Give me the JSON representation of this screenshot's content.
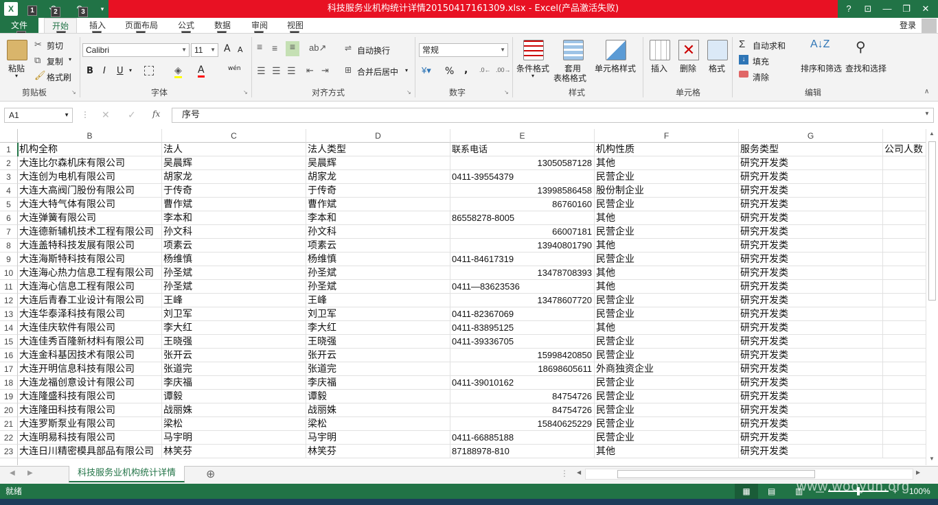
{
  "window": {
    "title": "科技服务业机构统计详情20150417161309.xlsx -  Excel(产品激活失败)",
    "help": "?",
    "restore_ribbon": "⊡",
    "minimize": "—",
    "maximize": "❐",
    "close": "✕",
    "login": "登录",
    "qat_keytips": [
      "1",
      "2",
      "3"
    ]
  },
  "tabs": [
    {
      "label": "文件",
      "key": "F"
    },
    {
      "label": "开始",
      "key": "H"
    },
    {
      "label": "插入",
      "key": "N"
    },
    {
      "label": "页面布局",
      "key": "P"
    },
    {
      "label": "公式",
      "key": "M"
    },
    {
      "label": "数据",
      "key": "A"
    },
    {
      "label": "审阅",
      "key": "R"
    },
    {
      "label": "视图",
      "key": "W"
    }
  ],
  "ribbon": {
    "clipboard": {
      "paste": "粘贴",
      "cut": "剪切",
      "copy": "复制",
      "format_painter": "格式刷",
      "label": "剪贴板"
    },
    "font": {
      "name": "Calibri",
      "size": "11",
      "label": "字体",
      "bold": "B",
      "italic": "I",
      "underline": "U",
      "grow": "A",
      "shrink": "A",
      "phonetic": "wén"
    },
    "alignment": {
      "wrap": "自动换行",
      "merge": "合并后居中",
      "label": "对齐方式"
    },
    "number": {
      "format": "常规",
      "percent": "%",
      "comma": ",",
      "label": "数字"
    },
    "styles": {
      "conditional": "条件格式",
      "table1": "套用",
      "table2": "表格格式",
      "cell_styles": "单元格样式",
      "label": "样式"
    },
    "cells": {
      "insert": "插入",
      "delete": "删除",
      "format": "格式",
      "label": "单元格"
    },
    "editing": {
      "autosum": "自动求和",
      "fill": "填充",
      "clear": "清除",
      "sort": "排序和筛选",
      "find": "查找和选择",
      "label": "编辑"
    }
  },
  "formula_bar": {
    "name_box": "A1",
    "fx": "fx",
    "value": "序号"
  },
  "columns": [
    "B",
    "C",
    "D",
    "E",
    "F",
    "G"
  ],
  "rows": [
    {
      "n": "1",
      "b": "机构全称",
      "c": "法人",
      "d": "法人类型",
      "e": "联系电话",
      "e_num": false,
      "f": "机构性质",
      "g": "服务类型",
      "h": "公司人数"
    },
    {
      "n": "2",
      "b": "大连比尔森机床有限公司",
      "c": "吴晨辉",
      "d": "吴晨辉",
      "e": "13050587128",
      "e_num": true,
      "f": "其他",
      "g": "研究开发类",
      "h": ""
    },
    {
      "n": "3",
      "b": "大连创为电机有限公司",
      "c": "胡家龙",
      "d": "胡家龙",
      "e": "0411-39554379",
      "e_num": false,
      "f": "民营企业",
      "g": "研究开发类",
      "h": ""
    },
    {
      "n": "4",
      "b": "大连大高阀门股份有限公司",
      "c": "于传奇",
      "d": "于传奇",
      "e": "13998586458",
      "e_num": true,
      "f": "股份制企业",
      "g": "研究开发类",
      "h": ""
    },
    {
      "n": "5",
      "b": "大连大特气体有限公司",
      "c": "曹作斌",
      "d": "曹作斌",
      "e": "86760160",
      "e_num": true,
      "f": "民营企业",
      "g": "研究开发类",
      "h": ""
    },
    {
      "n": "6",
      "b": "大连弹簧有限公司",
      "c": "李本和",
      "d": "李本和",
      "e": "86558278-8005",
      "e_num": false,
      "f": "其他",
      "g": "研究开发类",
      "h": ""
    },
    {
      "n": "7",
      "b": "大连德新辅机技术工程有限公司",
      "c": "孙文科",
      "d": "孙文科",
      "e": "66007181",
      "e_num": true,
      "f": "民营企业",
      "g": "研究开发类",
      "h": ""
    },
    {
      "n": "8",
      "b": "大连盖特科技发展有限公司",
      "c": "项素云",
      "d": "项素云",
      "e": "13940801790",
      "e_num": true,
      "f": "其他",
      "g": "研究开发类",
      "h": ""
    },
    {
      "n": "9",
      "b": "大连海斯特科技有限公司",
      "c": "杨维慎",
      "d": "杨维慎",
      "e": "0411-84617319",
      "e_num": false,
      "f": "民营企业",
      "g": "研究开发类",
      "h": ""
    },
    {
      "n": "10",
      "b": "大连海心热力信息工程有限公司",
      "c": "孙圣斌",
      "d": "孙圣斌",
      "e": "13478708393",
      "e_num": true,
      "f": "其他",
      "g": "研究开发类",
      "h": ""
    },
    {
      "n": "11",
      "b": "大连海心信息工程有限公司",
      "c": "孙圣斌",
      "d": "孙圣斌",
      "e": "0411—83623536",
      "e_num": false,
      "f": "其他",
      "g": "研究开发类",
      "h": ""
    },
    {
      "n": "12",
      "b": "大连后青春工业设计有限公司",
      "c": "王峰",
      "d": "王峰",
      "e": "13478607720",
      "e_num": true,
      "f": "民营企业",
      "g": "研究开发类",
      "h": ""
    },
    {
      "n": "13",
      "b": "大连华泰泽科技有限公司",
      "c": "刘卫军",
      "d": "刘卫军",
      "e": "0411-82367069",
      "e_num": false,
      "f": "民营企业",
      "g": "研究开发类",
      "h": ""
    },
    {
      "n": "14",
      "b": "大连佳庆软件有限公司",
      "c": "李大红",
      "d": "李大红",
      "e": "0411-83895125",
      "e_num": false,
      "f": "其他",
      "g": "研究开发类",
      "h": ""
    },
    {
      "n": "15",
      "b": "大连佳秀百隆新材料有限公司",
      "c": "王晓强",
      "d": "王晓强",
      "e": "0411-39336705",
      "e_num": false,
      "f": "民营企业",
      "g": "研究开发类",
      "h": ""
    },
    {
      "n": "16",
      "b": "大连金科基因技术有限公司",
      "c": "张开云",
      "d": "张开云",
      "e": "15998420850",
      "e_num": true,
      "f": "民营企业",
      "g": "研究开发类",
      "h": ""
    },
    {
      "n": "17",
      "b": "大连开明信息科技有限公司",
      "c": "张道完",
      "d": "张道完",
      "e": "18698605611",
      "e_num": true,
      "f": "外商独资企业",
      "g": "研究开发类",
      "h": ""
    },
    {
      "n": "18",
      "b": "大连龙福创意设计有限公司",
      "c": "李庆福",
      "d": "李庆福",
      "e": "0411-39010162",
      "e_num": false,
      "f": "民营企业",
      "g": "研究开发类",
      "h": ""
    },
    {
      "n": "19",
      "b": "大连隆盛科技有限公司",
      "c": "谭毅",
      "d": "谭毅",
      "e": "84754726",
      "e_num": true,
      "f": "民营企业",
      "g": "研究开发类",
      "h": ""
    },
    {
      "n": "20",
      "b": "大连隆田科技有限公司",
      "c": "战丽姝",
      "d": "战丽姝",
      "e": "84754726",
      "e_num": true,
      "f": "民营企业",
      "g": "研究开发类",
      "h": ""
    },
    {
      "n": "21",
      "b": "大连罗斯泵业有限公司",
      "c": "梁松",
      "d": "梁松",
      "e": "15840625229",
      "e_num": true,
      "f": "民营企业",
      "g": "研究开发类",
      "h": ""
    },
    {
      "n": "22",
      "b": "大连明易科技有限公司",
      "c": "马宇明",
      "d": "马宇明",
      "e": "0411-66885188",
      "e_num": false,
      "f": "民营企业",
      "g": "研究开发类",
      "h": ""
    },
    {
      "n": "23",
      "b": "大连日川精密模具部品有限公司",
      "c": "林笑芬",
      "d": "林笑芬",
      "e": "87188978-810",
      "e_num": false,
      "f": "其他",
      "g": "研究开发类",
      "h": ""
    }
  ],
  "sheet_tab": "科技服务业机构统计详情",
  "add_sheet": "⊕",
  "status": {
    "text": "就绪",
    "zoom": "100%"
  },
  "watermark": "www.wooyun.org"
}
